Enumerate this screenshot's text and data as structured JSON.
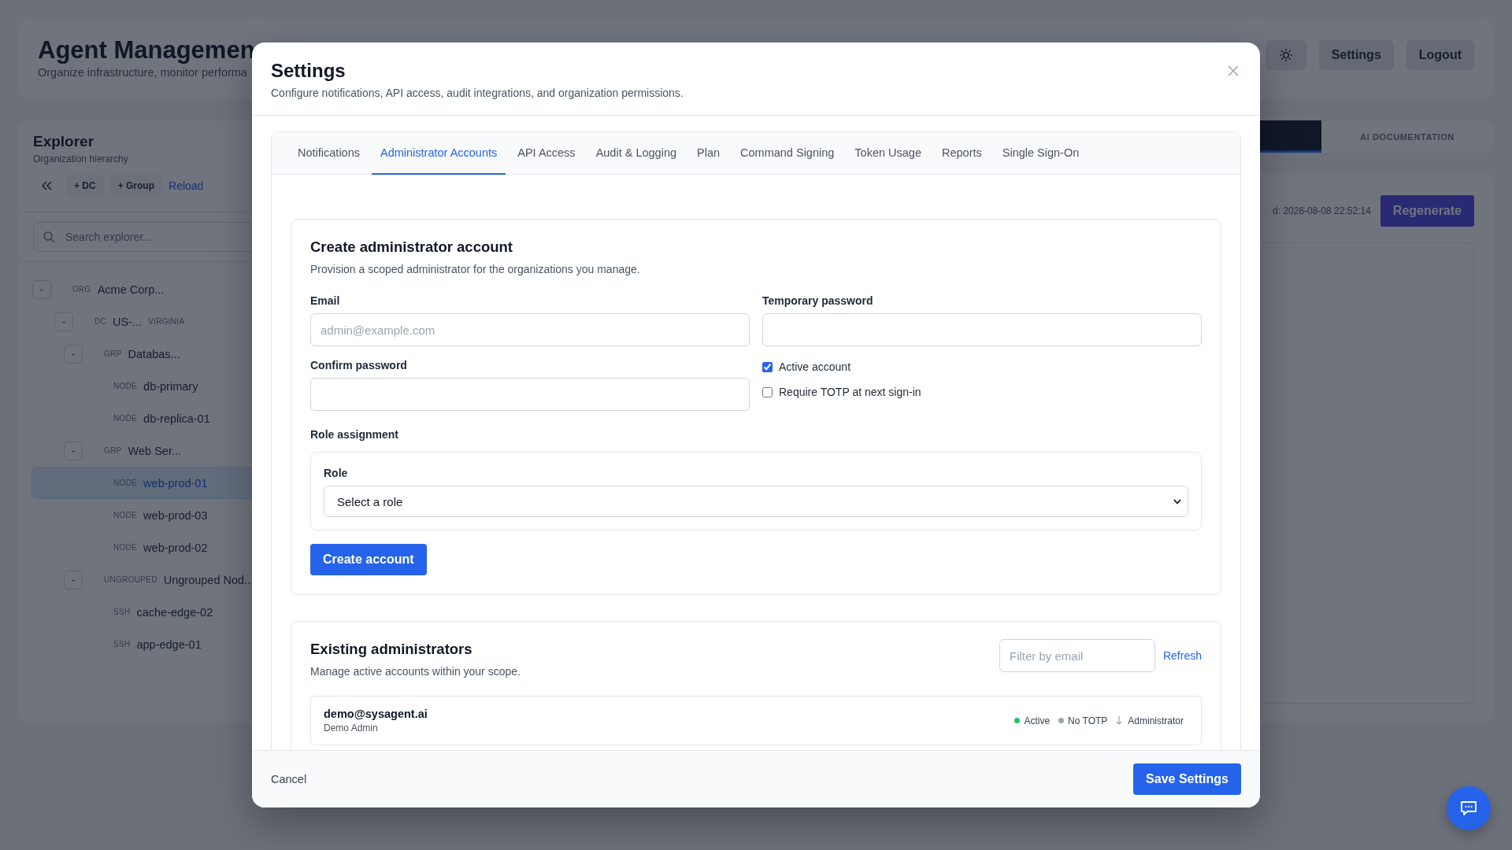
{
  "app": {
    "title": "Agent Managemen",
    "subtitle": "Organize infrastructure, monitor performa",
    "buttons": [
      "Settings",
      "Logout"
    ]
  },
  "explorer": {
    "title": "Explorer",
    "subtitle": "Organization hierarchy",
    "actions": [
      "+ DC",
      "+ Group"
    ],
    "reload": "Reload",
    "search": {
      "placeholder": "Search explorer..."
    },
    "tree": [
      {
        "type": "ORG",
        "name": "Acme Corp...",
        "toggle": "-",
        "selected": false,
        "children": [
          {
            "type": "DC",
            "name": "US-...",
            "region": "VIRGINIA",
            "toggle": "-",
            "selected": false,
            "children": [
              {
                "type": "GRP",
                "name": "Databas...",
                "toggle": "-",
                "selected": false,
                "children": [
                  {
                    "type": "NODE",
                    "name": "db-primary",
                    "selected": false
                  },
                  {
                    "type": "NODE",
                    "name": "db-replica-01",
                    "selected": false
                  }
                ]
              },
              {
                "type": "GRP",
                "name": "Web Ser...",
                "toggle": "-",
                "selected": false,
                "children": [
                  {
                    "type": "NODE",
                    "name": "web-prod-01",
                    "selected": true
                  },
                  {
                    "type": "NODE",
                    "name": "web-prod-03",
                    "selected": false
                  },
                  {
                    "type": "NODE",
                    "name": "web-prod-02",
                    "selected": false
                  }
                ]
              },
              {
                "type": "UNGROUPED",
                "name": "Ungrouped Nod...",
                "toggle": "-",
                "selected": false,
                "children": [
                  {
                    "type": "SSH",
                    "name": "cache-edge-02",
                    "selected": false
                  },
                  {
                    "type": "SSH",
                    "name": "app-edge-01",
                    "selected": false
                  }
                ]
              }
            ]
          }
        ]
      }
    ]
  },
  "main": {
    "tabs": [
      {
        "selected": true
      },
      {
        "label": "AI DOCUMENTATION",
        "selected": false
      }
    ],
    "generated": "d: 2026-08-08 22:52:14",
    "regenerate": "Regenerate"
  },
  "modal": {
    "title": "Settings",
    "subtitle": "Configure notifications, API access, audit integrations, and organization permissions.",
    "tabs": [
      {
        "label": "Notifications",
        "selected": false
      },
      {
        "label": "Administrator Accounts",
        "selected": true
      },
      {
        "label": "API Access",
        "selected": false
      },
      {
        "label": "Audit & Logging",
        "selected": false
      },
      {
        "label": "Plan",
        "selected": false
      },
      {
        "label": "Command Signing",
        "selected": false
      },
      {
        "label": "Token Usage",
        "selected": false
      },
      {
        "label": "Reports",
        "selected": false
      },
      {
        "label": "Single Sign-On",
        "selected": false
      }
    ],
    "create": {
      "title": "Create administrator account",
      "subtitle": "Provision a scoped administrator for the organizations you manage.",
      "email": {
        "label": "Email",
        "placeholder": "admin@example.com"
      },
      "temp_password": {
        "label": "Temporary password"
      },
      "confirm_password": {
        "label": "Confirm password"
      },
      "options": [
        {
          "label": "Active account",
          "checked": true
        },
        {
          "label": "Require TOTP at next sign-in",
          "checked": false
        }
      ],
      "role_section": "Role assignment",
      "role": {
        "label": "Role",
        "value": "Select a role"
      },
      "submit": "Create account"
    },
    "existing": {
      "title": "Existing administrators",
      "subtitle": "Manage active accounts within your scope.",
      "filter": {
        "placeholder": "Filter by email"
      },
      "refresh": "Refresh",
      "accounts": [
        {
          "email": "demo@sysagent.ai",
          "name": "Demo Admin",
          "badges": [
            {
              "label": "Active",
              "color": "#22c55e"
            },
            {
              "label": "No TOTP",
              "color": "#9ca3af"
            }
          ],
          "role": "Administrator"
        }
      ]
    },
    "cancel": "Cancel",
    "save": "Save Settings"
  }
}
